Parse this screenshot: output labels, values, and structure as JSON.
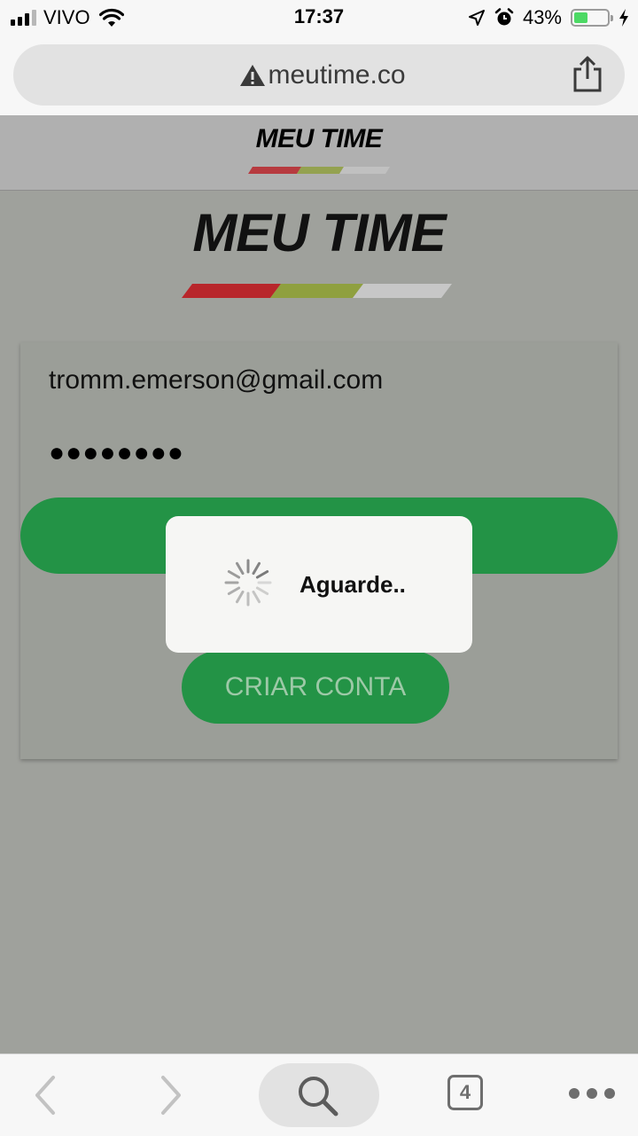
{
  "status_bar": {
    "carrier": "VIVO",
    "time": "17:37",
    "battery_percent": "43%",
    "battery_level": 0.43,
    "icons": [
      "signal-icon",
      "wifi-icon",
      "location-icon",
      "alarm-icon",
      "battery-icon",
      "charging-icon"
    ]
  },
  "browser": {
    "url": "meutime.co",
    "icons": [
      "warning-icon",
      "share-icon"
    ]
  },
  "header": {
    "brand": "MEU TIME"
  },
  "logo": {
    "brand": "MEU TIME",
    "stripe_colors": [
      "#b8262b",
      "#8fa03f",
      "#c7c7c7"
    ]
  },
  "form": {
    "email_value": "tromm.emerson@gmail.com",
    "password_mask": "●●●●●●●●",
    "create_account_label": "CRIAR CONTA"
  },
  "modal": {
    "message": "Aguarde.."
  },
  "toolbar": {
    "tab_count": "4",
    "icons": [
      "back-icon",
      "forward-icon",
      "search-icon",
      "tabs-icon",
      "more-icon"
    ]
  },
  "colors": {
    "primary_green": "#239346",
    "overlay": "#9fa19c",
    "modal_bg": "#f6f6f4"
  }
}
